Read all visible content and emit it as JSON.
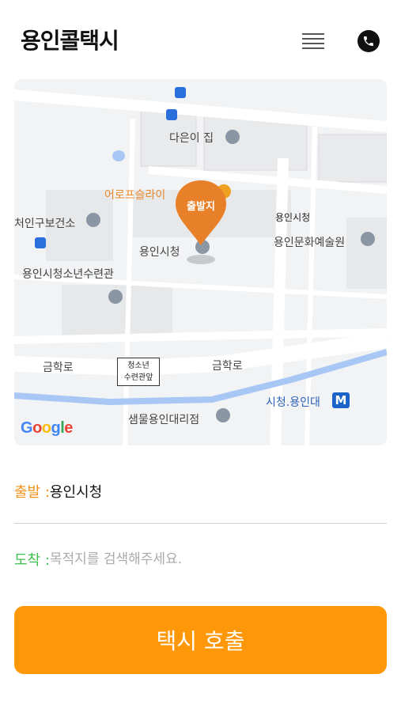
{
  "header": {
    "title": "용인콜택시",
    "menu_icon": "hamburger-menu-icon",
    "phone_icon": "phone-icon"
  },
  "map": {
    "marker_label": "출발지",
    "labels": {
      "house": "다은이 집",
      "cafe": "어로프슬라이",
      "health_center": "처인구보건소",
      "city_hall_building": "용인시청",
      "culture_center": "용인문화예술원",
      "city_hall": "용인시청",
      "youth_center": "용인시청소년수련관",
      "road_left": "금학로",
      "road_right": "금학로",
      "bus_stop_line1": "청소년",
      "bus_stop_line2": "수련관앞",
      "station": "시청.용인대",
      "station_icon": "M",
      "store": "샘물용인대리점",
      "google": [
        "G",
        "o",
        "o",
        "g",
        "l",
        "e"
      ]
    },
    "colors": {
      "marker": "#e8802a",
      "water": "#a8c7f5",
      "road": "#ffffff",
      "building": "#e8e9eb"
    }
  },
  "form": {
    "origin_label": "출발 :",
    "origin_value": "용인시청",
    "dest_label": "도착 :",
    "dest_placeholder": "목적지를 검색해주세요."
  },
  "call_button": {
    "label": "택시 호출",
    "color": "#ff9808"
  }
}
